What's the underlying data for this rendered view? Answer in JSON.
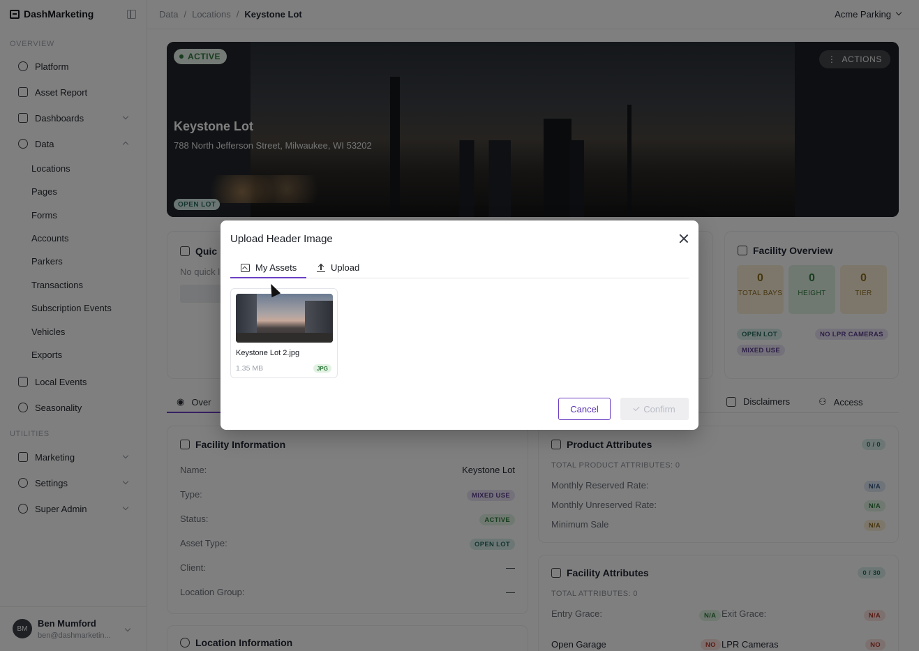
{
  "sidebar": {
    "brand": "DashMarketing",
    "overview_label": "OVERVIEW",
    "utilities_label": "UTILITIES",
    "items": [
      {
        "label": "Platform"
      },
      {
        "label": "Asset Report"
      },
      {
        "label": "Dashboards"
      },
      {
        "label": "Data"
      }
    ],
    "data_sub": [
      "Locations",
      "Pages",
      "Forms",
      "Accounts",
      "Parkers",
      "Transactions",
      "Subscription Events",
      "Vehicles",
      "Exports"
    ],
    "more_items": [
      {
        "label": "Local Events"
      },
      {
        "label": "Seasonality"
      }
    ],
    "utility_items": [
      {
        "label": "Marketing"
      },
      {
        "label": "Settings"
      },
      {
        "label": "Super Admin"
      }
    ],
    "user": {
      "initials": "BM",
      "name": "Ben Mumford",
      "email": "ben@dashmarketin..."
    }
  },
  "topbar": {
    "crumbs": [
      "Data",
      "/",
      "Locations",
      "/",
      "Keystone Lot"
    ],
    "org": "Acme Parking"
  },
  "hero": {
    "status": "ACTIVE",
    "actions": "ACTIONS",
    "title": "Keystone Lot",
    "address": "788 North Jefferson Street, Milwaukee, WI 53202",
    "type_badge": "OPEN LOT"
  },
  "quick": {
    "title": "Quic",
    "text": "No quick l"
  },
  "facility_overview": {
    "title": "Facility Overview",
    "stats": [
      {
        "value": "0",
        "label": "TOTAL BAYS"
      },
      {
        "value": "0",
        "label": "HEIGHT"
      },
      {
        "value": "0",
        "label": "TIER"
      }
    ],
    "tags": [
      "OPEN LOT",
      "NO LPR CAMERAS",
      "MIXED USE"
    ]
  },
  "tabs": {
    "overview": "Over",
    "disclaimers": "Disclaimers",
    "access": "Access"
  },
  "facility_info": {
    "title": "Facility Information",
    "rows": [
      {
        "label": "Name:",
        "value": "Keystone Lot"
      },
      {
        "label": "Type:",
        "value": "MIXED USE"
      },
      {
        "label": "Status:",
        "value": "ACTIVE"
      },
      {
        "label": "Asset Type:",
        "value": "OPEN LOT"
      },
      {
        "label": "Client:",
        "value": "—"
      },
      {
        "label": "Location Group:",
        "value": "—"
      }
    ]
  },
  "location_info": {
    "title": "Location Information"
  },
  "product_attrs": {
    "title": "Product Attributes",
    "count": "0 / 0",
    "total": "TOTAL PRODUCT ATTRIBUTES: 0",
    "rows": [
      {
        "label": "Monthly Reserved Rate:",
        "value": "N/A"
      },
      {
        "label": "Monthly Unreserved Rate:",
        "value": "N/A"
      },
      {
        "label": "Minimum Sale",
        "value": "N/A"
      }
    ]
  },
  "facility_attrs": {
    "title": "Facility Attributes",
    "count": "0 / 30",
    "total": "TOTAL ATTRIBUTES: 0",
    "entry_grace": "Entry Grace:",
    "entry_val": "N/A",
    "exit_grace": "Exit Grace:",
    "exit_val": "N/A",
    "open_garage": "Open Garage",
    "open_val": "NO",
    "lpr": "LPR Cameras",
    "lpr_val": "NO"
  },
  "modal": {
    "title": "Upload Header Image",
    "tab_assets": "My Assets",
    "tab_upload": "Upload",
    "asset": {
      "name": "Keystone Lot 2.jpg",
      "size": "1.35 MB",
      "type": "JPG"
    },
    "cancel": "Cancel",
    "confirm": "Confirm"
  },
  "colors": {
    "accent": "#6b3fc4",
    "overlay": "rgba(0,0,0,0.5)"
  }
}
